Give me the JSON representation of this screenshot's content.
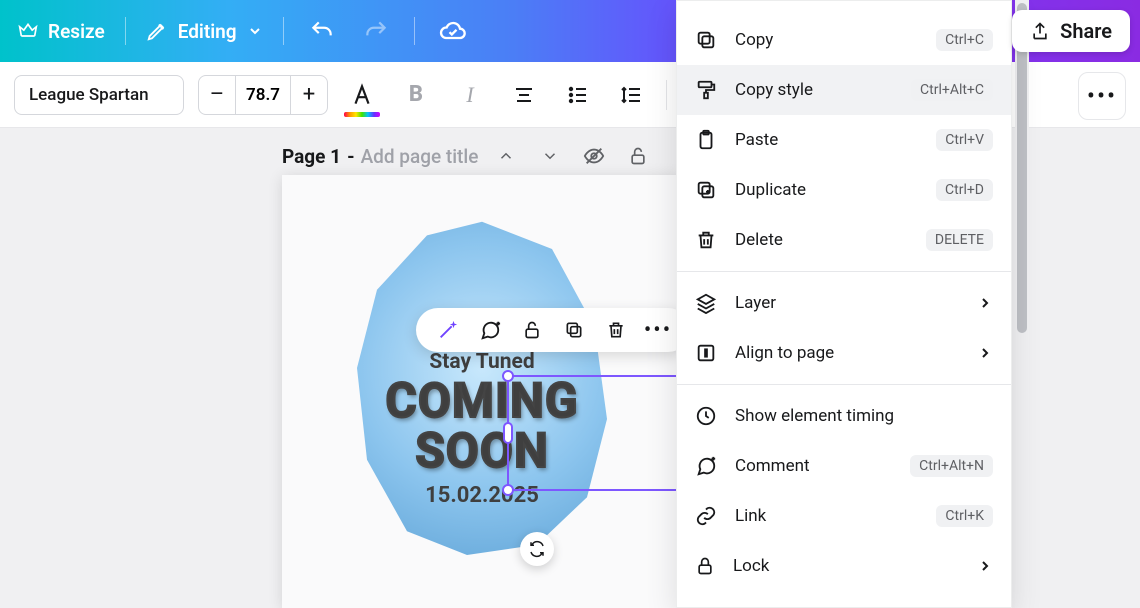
{
  "topbar": {
    "resize": "Resize",
    "editing": "Editing",
    "share": "Share"
  },
  "toolbar": {
    "font_name": "League Spartan",
    "font_size": "78.7"
  },
  "page_header": {
    "label": "Page 1",
    "sep": " - ",
    "placeholder": "Add page title"
  },
  "canvas": {
    "stay": "Stay Tuned",
    "coming": "COMING",
    "soon": "SOON",
    "date": "15.02.2025"
  },
  "ctx": {
    "copy": {
      "label": "Copy",
      "kbd": "Ctrl+C"
    },
    "copy_style": {
      "label": "Copy style",
      "kbd": "Ctrl+Alt+C"
    },
    "paste": {
      "label": "Paste",
      "kbd": "Ctrl+V"
    },
    "duplicate": {
      "label": "Duplicate",
      "kbd": "Ctrl+D"
    },
    "delete": {
      "label": "Delete",
      "kbd": "DELETE"
    },
    "layer": {
      "label": "Layer"
    },
    "align": {
      "label": "Align to page"
    },
    "timing": {
      "label": "Show element timing"
    },
    "comment": {
      "label": "Comment",
      "kbd": "Ctrl+Alt+N"
    },
    "link": {
      "label": "Link",
      "kbd": "Ctrl+K"
    },
    "lock": {
      "label": "Lock"
    }
  }
}
